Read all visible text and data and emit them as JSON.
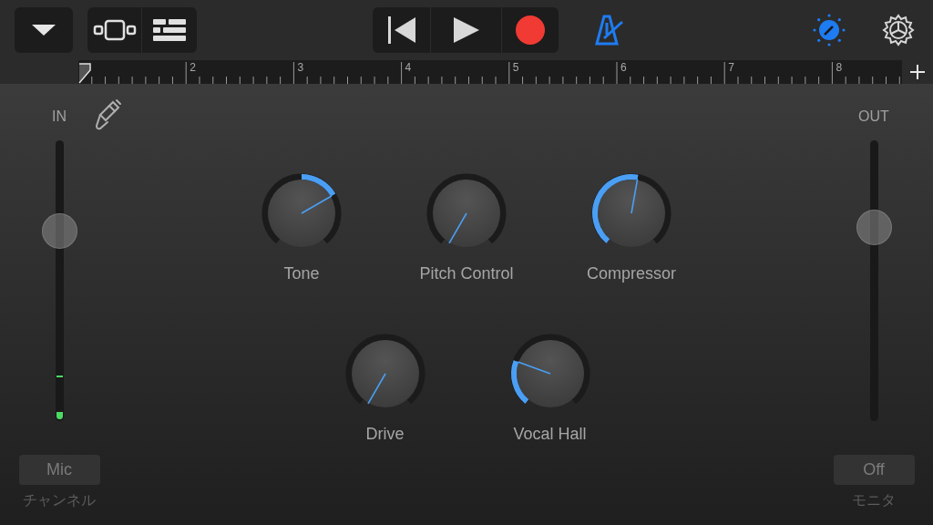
{
  "toolbar": {
    "metronome_on": true,
    "smart_controls_selected": true
  },
  "ruler": {
    "bars": [
      "2",
      "3",
      "4",
      "5",
      "6",
      "7",
      "8"
    ]
  },
  "input": {
    "label": "IN",
    "level": 0.68,
    "source_button": "Mic",
    "caption": "チャンネル"
  },
  "output": {
    "label": "OUT",
    "level": 0.69,
    "monitor_button": "Off",
    "caption": "モニタ"
  },
  "knobs": [
    {
      "label": "Tone",
      "kind": "centered"
    },
    {
      "label": "Pitch Control",
      "kind": "standard"
    },
    {
      "label": "Compressor",
      "kind": "standard"
    },
    {
      "label": "Drive",
      "kind": "standard"
    },
    {
      "label": "Vocal Hall",
      "kind": "standard"
    }
  ]
}
